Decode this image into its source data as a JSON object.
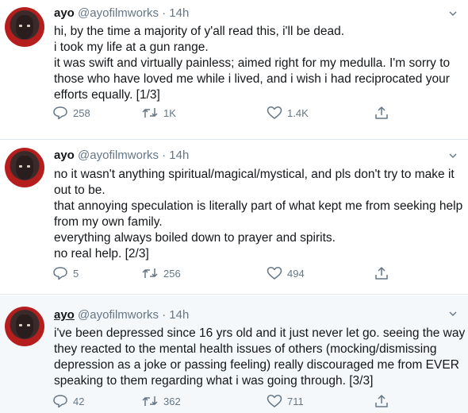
{
  "tweets": [
    {
      "name": "ayo",
      "handle": "@ayofilmworks",
      "time": "14h",
      "lines": [
        "hi, by the time a majority of y'all read this, i'll be dead.",
        "i took my life at a gun range.",
        "it was swift and virtually painless; aimed right for my medulla. I'm sorry to",
        "those who have loved me while i lived, and i wish i had reciprocated your",
        "efforts equally. [1/3]"
      ],
      "replies": "258",
      "retweets": "1K",
      "likes": "1.4K"
    },
    {
      "name": "ayo",
      "handle": "@ayofilmworks",
      "time": "14h",
      "lines": [
        "no it wasn't anything spiritual/magical/mystical, and pls don't try to make it",
        "out to be.",
        "that annoying speculation is literally part of what kept me from seeking help",
        "from my own family.",
        "everything always boiled down to prayer and spirits.",
        "no real help. [2/3]"
      ],
      "replies": "5",
      "retweets": "256",
      "likes": "494"
    },
    {
      "name": "ayo",
      "handle": "@ayofilmworks",
      "time": "14h",
      "lines": [
        "i've been depressed since 16 yrs old and it just never let go. seeing the way",
        "they reacted to the mental health issues of others (mocking/dismissing",
        "depression as a joke or passing feeling) really discouraged me from EVER",
        "speaking to them regarding what i was going through. [3/3]"
      ],
      "replies": "42",
      "retweets": "362",
      "likes": "711"
    }
  ],
  "icons": {
    "reply": "reply-icon",
    "retweet": "retweet-icon",
    "like": "heart-icon",
    "share": "share-icon",
    "caret": "chevron-down-icon"
  },
  "colors": {
    "text": "#14171a",
    "muted": "#657786",
    "highlight_bg": "#f5f8fa",
    "divider": "#e1e8ed"
  }
}
